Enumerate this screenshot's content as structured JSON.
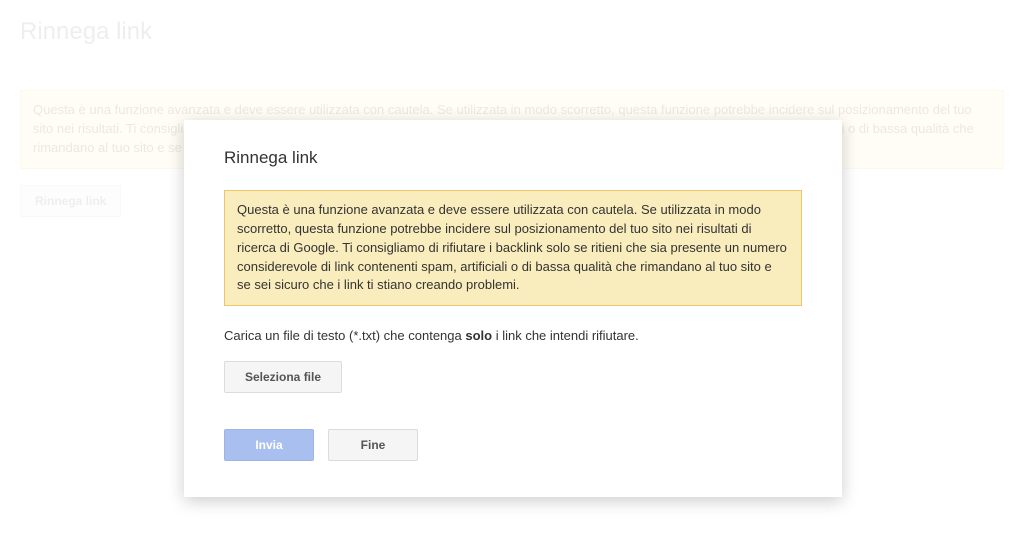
{
  "page": {
    "title": "Rinnega link",
    "backgroundWarning": "Questa è una funzione avanzata e deve essere utilizzata con cautela. Se utilizzata in modo scorretto, questa funzione potrebbe incidere sul posizionamento del tuo sito nei risultati. Ti consigliamo di rifiutare i backlink solo se ritieni che sia presente un numero considerevole di link contenenti spam, artificiali o di bassa qualità che rimandano al tuo sito e se sei stiano creando problemi.",
    "bgButtonLabel": "Rinnega link"
  },
  "modal": {
    "title": "Rinnega link",
    "warning": "Questa è una funzione avanzata e deve essere utilizzata con cautela. Se utilizzata in modo scorretto, questa funzione potrebbe incidere sul posizionamento del tuo sito nei risultati di ricerca di Google. Ti consigliamo di rifiutare i backlink solo se ritieni che sia presente un numero considerevole di link contenenti spam, artificiali o di bassa qualità che rimandano al tuo sito e se sei sicuro che i link ti stiano creando problemi.",
    "uploadPrefix": "Carica un file di testo (*.txt) che contenga ",
    "uploadBold": "solo",
    "uploadSuffix": " i link che intendi rifiutare.",
    "selectFileLabel": "Seleziona file",
    "submitLabel": "Invia",
    "doneLabel": "Fine"
  }
}
